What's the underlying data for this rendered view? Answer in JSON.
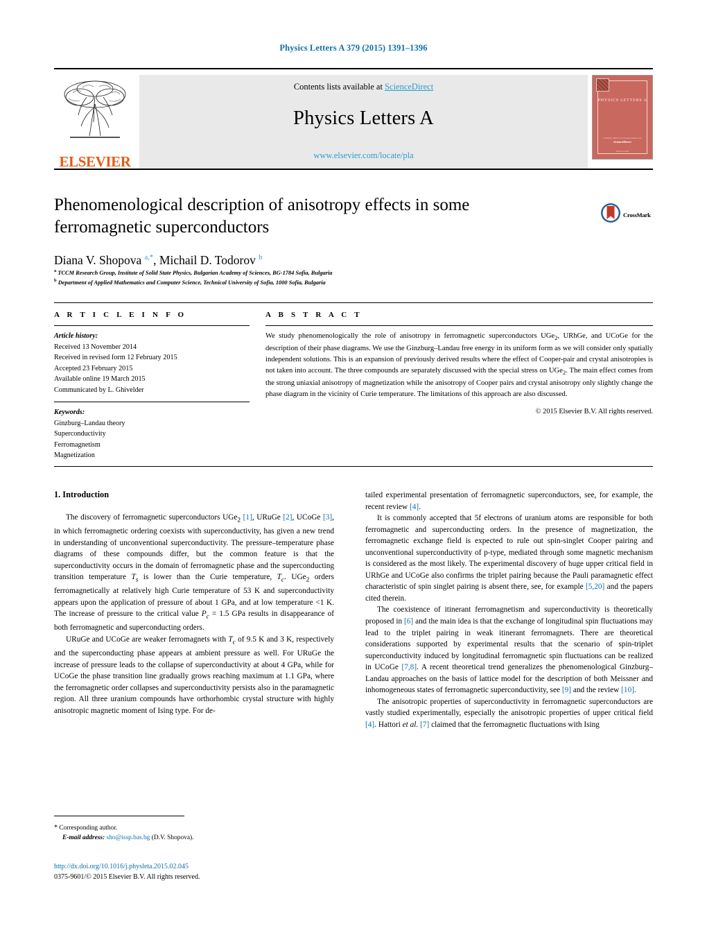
{
  "running_head": "Physics Letters A 379 (2015) 1391–1396",
  "masthead": {
    "contents_prefix": "Contents lists available at ",
    "sciencedirect": "ScienceDirect",
    "journal_title": "Physics Letters A",
    "journal_url": "www.elsevier.com/locate/pla",
    "publisher": "ELSEVIER",
    "cover": {
      "name": "PHYSICS LETTERS A",
      "foot1": "Editor-in-Chief",
      "foot2": "ScienceDirect",
      "foot3": "Available online at www.sciencedirect.com"
    },
    "colors": {
      "link": "#2e9ad0",
      "elsevier_orange": "#E55B13",
      "cover_red": "#c9685e",
      "banner_grey": "#e9e9e9"
    }
  },
  "article": {
    "title": "Phenomenological description of anisotropy effects in some ferromagnetic superconductors",
    "authors_html": "Diana V. Shopova <sup>a,*</sup>, Michail D. Todorov <sup>b</sup>",
    "affiliation_a": "TCCM Research Group, Institute of Solid State Physics, Bulgarian Academy of Sciences, BG-1784 Sofia, Bulgaria",
    "affiliation_b": "Department of Applied Mathematics and Computer Science, Technical University of Sofia, 1000 Sofia, Bulgaria",
    "crossmark_label": "CrossMark"
  },
  "info": {
    "heading": "A R T I C L E    I N F O",
    "history_label": "Article history:",
    "history": [
      "Received 13 November 2014",
      "Received in revised form 12 February 2015",
      "Accepted 23 February 2015",
      "Available online 19 March 2015",
      "Communicated by L. Ghivelder"
    ],
    "keywords_label": "Keywords:",
    "keywords": [
      "Ginzburg–Landau theory",
      "Superconductivity",
      "Ferromagnetism",
      "Magnetization"
    ]
  },
  "abstract": {
    "heading": "A B S T R A C T",
    "text": "We study phenomenologically the role of anisotropy in ferromagnetic superconductors UGe2, URhGe, and UCoGe for the description of their phase diagrams. We use the Ginzburg–Landau free energy in its uniform form as we will consider only spatially independent solutions. This is an expansion of previously derived results where the effect of Cooper-pair and crystal anisotropies is not taken into account. The three compounds are separately discussed with the special stress on UGe2. The main effect comes from the strong uniaxial anisotropy of magnetization while the anisotropy of Cooper pairs and crystal anisotropy only slightly change the phase diagram in the vicinity of Curie temperature. The limitations of this approach are also discussed.",
    "copyright": "© 2015 Elsevier B.V. All rights reserved."
  },
  "body": {
    "section_title": "1. Introduction",
    "left_paragraphs": [
      "The discovery of ferromagnetic superconductors UGe2 [1], URuGe [2], UCoGe [3], in which ferromagnetic ordering coexists with superconductivity, has given a new trend in understanding of unconventional superconductivity. The pressure–temperature phase diagrams of these compounds differ, but the common feature is that the superconductivity occurs in the domain of ferromagnetic phase and the superconducting transition temperature Ts is lower than the Curie temperature, Tc. UGe2 orders ferromagnetically at relatively high Curie temperature of 53 K and superconductivity appears upon the application of pressure of about 1 GPa, and at low temperature <1 K. The increase of pressure to the critical value Pc = 1.5 GPa results in disappearance of both ferromagnetic and superconducting orders.",
      "URuGe and UCoGe are weaker ferromagnets with Tc of 9.5 K and 3 K, respectively and the superconducting phase appears at ambient pressure as well. For URuGe the increase of pressure leads to the collapse of superconductivity at about 4 GPa, while for UCoGe the phase transition line gradually grows reaching maximum at 1.1 GPa, where the ferromagnetic order collapses and superconductivity persists also in the paramagnetic region. All three uranium compounds have orthorhombic crystal structure with highly anisotropic magnetic moment of Ising type. For de-"
    ],
    "right_paragraphs": [
      "tailed experimental presentation of ferromagnetic superconductors, see, for example, the recent review [4].",
      "It is commonly accepted that 5f electrons of uranium atoms are responsible for both ferromagnetic and superconducting orders. In the presence of magnetization, the ferromagnetic exchange field is expected to rule out spin-singlet Cooper pairing and unconventional superconductivity of p-type, mediated through some magnetic mechanism is considered as the most likely. The experimental discovery of huge upper critical field in URhGe and UCoGe also confirms the triplet pairing because the Pauli paramagnetic effect characteristic of spin singlet pairing is absent there, see, for example [5,20] and the papers cited therein.",
      "The coexistence of itinerant ferromagnetism and superconductivity is theoretically proposed in [6] and the main idea is that the exchange of longitudinal spin fluctuations may lead to the triplet pairing in weak itinerant ferromagnets. There are theoretical considerations supported by experimental results that the scenario of spin-triplet superconductivity induced by longitudinal ferromagnetic spin fluctuations can be realized in UCoGe [7,8]. A recent theoretical trend generalizes the phenomenological Ginzburg–Landau approaches on the basis of lattice model for the description of both Meissner and inhomogeneous states of ferromagnetic superconductivity, see [9] and the review [10].",
      "The anisotropic properties of superconductivity in ferromagnetic superconductors are vastly studied experimentally, especially the anisotropic properties of upper critical field [4]. Hattori et al. [7] claimed that the ferromagnetic fluctuations with Ising"
    ]
  },
  "footer": {
    "corresponding_marker": "*",
    "corresponding_text": "Corresponding author.",
    "email_label": "E-mail address:",
    "email": "sho@issp.bas.bg",
    "email_owner": "(D.V. Shopova).",
    "doi": "http://dx.doi.org/10.1016/j.physleta.2015.02.045",
    "issn_line": "0375-9601/© 2015 Elsevier B.V. All rights reserved."
  }
}
